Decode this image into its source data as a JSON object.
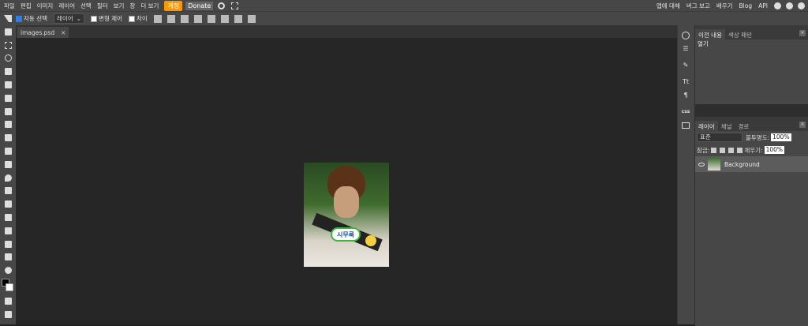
{
  "menu": {
    "items": [
      "파일",
      "편집",
      "이미지",
      "레이어",
      "선택",
      "필터",
      "보기",
      "창",
      "더 보기"
    ],
    "account": "계정",
    "donate": "Donate",
    "right": [
      "앱에 대해",
      "버그 보고",
      "배우기",
      "Blog",
      "API"
    ]
  },
  "options": {
    "auto_select": "자동 선택",
    "layer_select": "레이어",
    "transform": "변형 제어",
    "distance": "차이"
  },
  "document": {
    "tab": "images.psd",
    "close": "×"
  },
  "image": {
    "caption": "시무룩"
  },
  "history_panel": {
    "tab_history": "이전 내용",
    "tab_swatches": "색상 패턴",
    "item": "열기"
  },
  "layers_panel": {
    "tab_layers": "레이어",
    "tab_channels": "채널",
    "tab_paths": "경로",
    "blend_mode": "표준",
    "opacity_label": "불투명도:",
    "opacity": "100%",
    "lock_label": "잠금:",
    "fill_label": "채우기:",
    "fill": "100%",
    "layer_name": "Background"
  },
  "iconcol": {
    "css": "css",
    "text": "Tt",
    "para": "¶"
  }
}
